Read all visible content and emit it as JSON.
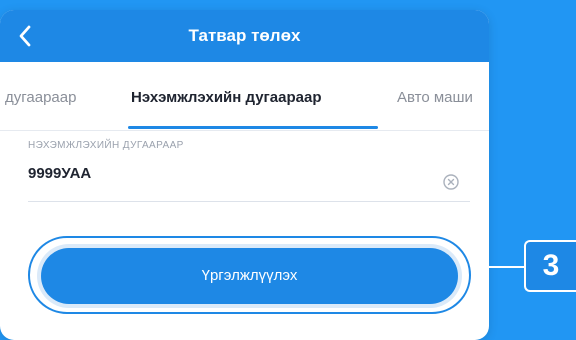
{
  "header": {
    "title": "Татвар төлөх"
  },
  "tabs": [
    {
      "label": "дугаараар"
    },
    {
      "label": "Нэхэмжлэхийн дугаараар"
    },
    {
      "label": "Авто маши"
    }
  ],
  "field": {
    "label": "НЭХЭМЖЛЭХИЙН ДУГААРААР",
    "value": "9999УАА"
  },
  "continue_button": {
    "label": "Үргэлжлүүлэх"
  },
  "step_badge": {
    "number": "3"
  },
  "colors": {
    "background": "#2196F3",
    "accent": "#1E88E5",
    "text": "#1f2430",
    "muted": "#8a8f99"
  },
  "icons": {
    "back": "chevron-left-icon",
    "clear": "clear-circle-icon"
  }
}
